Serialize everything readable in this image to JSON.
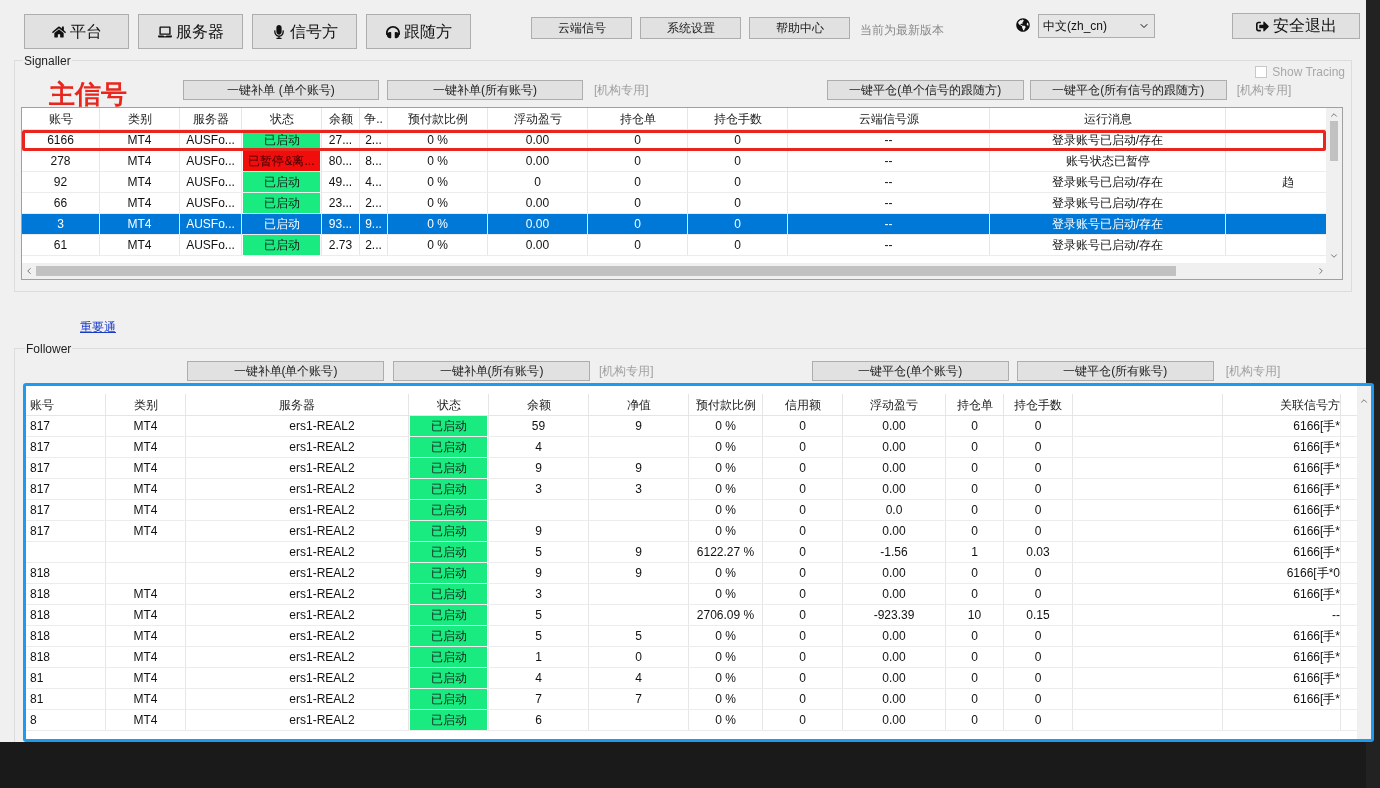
{
  "toolbar": {
    "nav_buttons": [
      "平台",
      "服务器",
      "信号方",
      "跟随方"
    ],
    "actions": [
      "云端信号",
      "系统设置",
      "帮助中心"
    ],
    "version_note": "当前为最新版本",
    "language": {
      "value": "中文(zh_cn)"
    },
    "logout": "安全退出"
  },
  "signaller": {
    "title": "Signaller",
    "annotation": "主信号",
    "show_tracing": {
      "label": "Show Tracing",
      "checked": false
    },
    "buttons_left": [
      "一键补单 (单个账号)",
      "一键补单(所有账号)"
    ],
    "note_left": "[机构专用]",
    "buttons_right": [
      "一键平仓(单个信号的跟随方)",
      "一键平仓(所有信号的跟随方)"
    ],
    "note_right": "[机构专用]",
    "columns": [
      "账号",
      "类别",
      "服务器",
      "状态",
      "余额",
      "争..",
      "预付款比例",
      "浮动盈亏",
      "持仓单",
      "持仓手数",
      "云端信号源",
      "运行消息",
      null
    ],
    "rows": [
      {
        "selected": false,
        "annotated": true,
        "kind": "running",
        "cells": [
          "6166",
          "MT4",
          "AUSFo...",
          "已启动",
          "27...",
          "2...",
          "0 %",
          "0.00",
          "0",
          "0",
          "--",
          "登录账号已启动/存在",
          null
        ]
      },
      {
        "selected": false,
        "annotated": false,
        "kind": "paused",
        "cells": [
          "278",
          "MT4",
          "AUSFo...",
          "已暂停&离...",
          "80...",
          "8...",
          "0 %",
          "0.00",
          "0",
          "0",
          "--",
          "账号状态已暂停",
          null
        ]
      },
      {
        "selected": false,
        "annotated": false,
        "kind": "running",
        "cells": [
          "92",
          "MT4",
          "AUSFo...",
          "已启动",
          "49...",
          "4...",
          "0 %",
          "0",
          "0",
          "0",
          "--",
          "登录账号已启动/存在",
          "趋"
        ]
      },
      {
        "selected": false,
        "annotated": false,
        "kind": "running",
        "cells": [
          "66",
          "MT4",
          "AUSFo...",
          "已启动",
          "23...",
          "2...",
          "0 %",
          "0.00",
          "0",
          "0",
          "--",
          "登录账号已启动/存在",
          null
        ]
      },
      {
        "selected": true,
        "annotated": false,
        "kind": "running",
        "cells": [
          "3",
          "MT4",
          "AUSFo...",
          "已启动",
          "93...",
          "9...",
          "0 %",
          "0.00",
          "0",
          "0",
          "--",
          "登录账号已启动/存在",
          null
        ]
      },
      {
        "selected": false,
        "annotated": false,
        "kind": "running",
        "cells": [
          "61",
          "MT4",
          "AUSFo...",
          "已启动",
          "2.73",
          "2...",
          "0 %",
          "0.00",
          "0",
          "0",
          "--",
          "登录账号已启动/存在",
          null
        ]
      }
    ]
  },
  "notice_link": "重要通",
  "follower": {
    "title": "Follower",
    "buttons_left": [
      "一键补单(单个账号)",
      "一键补单(所有账号)"
    ],
    "note_left": "[机构专用]",
    "buttons_right": [
      "一键平仓(单个账号)",
      "一键平仓(所有账号)"
    ],
    "note_right": "[机构专用]",
    "columns": [
      "账号",
      "类别",
      "服务器",
      "状态",
      "余额",
      "净值",
      "预付款比例",
      "信用额",
      "浮动盈亏",
      "持仓单",
      "持仓手数",
      null,
      "关联信号方"
    ],
    "rows": [
      {
        "kind": "running",
        "cells": [
          "817",
          "MT4",
          "ers1-REAL2",
          "已启动",
          "59",
          "9",
          "0 %",
          "0",
          "0.00",
          "0",
          "0",
          null,
          "6166[手*"
        ]
      },
      {
        "kind": "running",
        "cells": [
          "817",
          "MT4",
          "ers1-REAL2",
          "已启动",
          "4",
          null,
          "0 %",
          "0",
          "0.00",
          "0",
          "0",
          null,
          "6166[手*"
        ]
      },
      {
        "kind": "running",
        "cells": [
          "817",
          "MT4",
          "ers1-REAL2",
          "已启动",
          "9",
          "9",
          "0 %",
          "0",
          "0.00",
          "0",
          "0",
          null,
          "6166[手*"
        ]
      },
      {
        "kind": "running",
        "cells": [
          "817",
          "MT4",
          "ers1-REAL2",
          "已启动",
          "3",
          "3",
          "0 %",
          "0",
          "0.00",
          "0",
          "0",
          null,
          "6166[手*"
        ]
      },
      {
        "kind": "running",
        "cells": [
          "817",
          "MT4",
          "ers1-REAL2",
          "已启动",
          null,
          null,
          "0 %",
          "0",
          "0.0",
          "0",
          "0",
          null,
          "6166[手*"
        ]
      },
      {
        "kind": "running",
        "cells": [
          "817",
          "MT4",
          "ers1-REAL2",
          "已启动",
          "9",
          null,
          "0 %",
          "0",
          "0.00",
          "0",
          "0",
          null,
          "6166[手*"
        ]
      },
      {
        "kind": "running",
        "cells": [
          null,
          null,
          "ers1-REAL2",
          "已启动",
          "5",
          "9",
          "6122.27 %",
          "0",
          "-1.56",
          "1",
          "0.03",
          null,
          "6166[手*"
        ]
      },
      {
        "kind": "running",
        "cells": [
          "818",
          null,
          "ers1-REAL2",
          "已启动",
          "9",
          "9",
          "0 %",
          "0",
          "0.00",
          "0",
          "0",
          null,
          "6166[手*0"
        ]
      },
      {
        "kind": "running",
        "cells": [
          "818",
          "MT4",
          "ers1-REAL2",
          "已启动",
          "3",
          null,
          "0 %",
          "0",
          "0.00",
          "0",
          "0",
          null,
          "6166[手*"
        ]
      },
      {
        "kind": "running",
        "cells": [
          "818",
          "MT4",
          "ers1-REAL2",
          "已启动",
          "5",
          null,
          "2706.09 %",
          "0",
          "-923.39",
          "10",
          "0.15",
          null,
          "--"
        ]
      },
      {
        "kind": "running",
        "cells": [
          "818",
          "MT4",
          "ers1-REAL2",
          "已启动",
          "5",
          "5",
          "0 %",
          "0",
          "0.00",
          "0",
          "0",
          null,
          "6166[手*"
        ]
      },
      {
        "kind": "running",
        "cells": [
          "818",
          "MT4",
          "ers1-REAL2",
          "已启动",
          "1",
          "0",
          "0 %",
          "0",
          "0.00",
          "0",
          "0",
          null,
          "6166[手*"
        ]
      },
      {
        "kind": "running",
        "cells": [
          "81",
          "MT4",
          "ers1-REAL2",
          "已启动",
          "4",
          "4",
          "0 %",
          "0",
          "0.00",
          "0",
          "0",
          null,
          "6166[手*"
        ]
      },
      {
        "kind": "running",
        "cells": [
          "81",
          "MT4",
          "ers1-REAL2",
          "已启动",
          "7",
          "7",
          "0 %",
          "0",
          "0.00",
          "0",
          "0",
          null,
          "6166[手*"
        ]
      },
      {
        "kind": "running",
        "cells": [
          "8",
          "MT4",
          "ers1-REAL2",
          "已启动",
          "6",
          null,
          "0 %",
          "0",
          "0.00",
          "0",
          "0",
          null,
          null
        ]
      }
    ]
  }
}
